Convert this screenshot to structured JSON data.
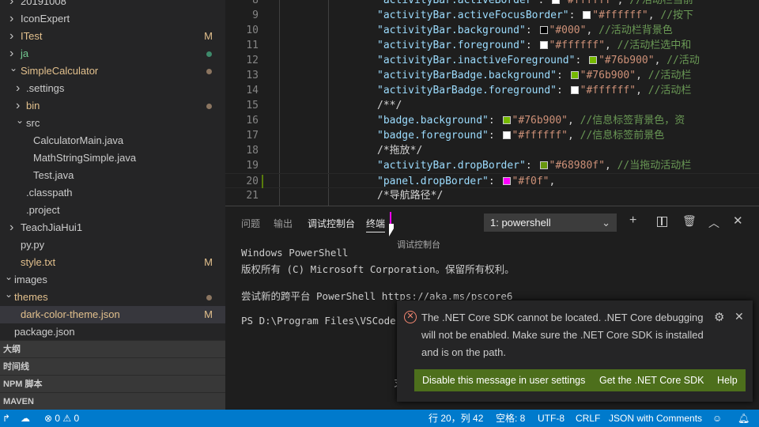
{
  "explorer": {
    "items": [
      {
        "label": "20191008",
        "indent": 0,
        "chevron": "right",
        "cls": ""
      },
      {
        "label": "IconExpert",
        "indent": 0,
        "chevron": "right",
        "cls": ""
      },
      {
        "label": "ITest",
        "indent": 0,
        "chevron": "right",
        "cls": "mod",
        "badge": "M"
      },
      {
        "label": "ja",
        "indent": 0,
        "chevron": "right",
        "cls": "ja",
        "dot": "#3e8a6b"
      },
      {
        "label": "SimpleCalculator",
        "indent": 0,
        "chevron": "down",
        "cls": "mod",
        "dot": "#8b7560"
      },
      {
        "label": ".settings",
        "indent": 1,
        "chevron": "right",
        "cls": ""
      },
      {
        "label": "bin",
        "indent": 1,
        "chevron": "right",
        "cls": "mod",
        "dot": "#8b7560"
      },
      {
        "label": "src",
        "indent": 1,
        "chevron": "down",
        "cls": ""
      },
      {
        "label": "CalculatorMain.java",
        "indent": 2,
        "cls": ""
      },
      {
        "label": "MathStringSimple.java",
        "indent": 2,
        "cls": ""
      },
      {
        "label": "Test.java",
        "indent": 2,
        "cls": ""
      },
      {
        "label": ".classpath",
        "indent": 1,
        "cls": ""
      },
      {
        "label": ".project",
        "indent": 1,
        "cls": ""
      },
      {
        "label": "TeachJiaHui1",
        "indent": 0,
        "chevron": "right",
        "cls": ""
      },
      {
        "label": "py.py",
        "indent": 0,
        "cls": ""
      },
      {
        "label": "style.txt",
        "indent": 0,
        "cls": "mod",
        "badge": "M"
      },
      {
        "label": "images",
        "indent": -1,
        "chevron": "down",
        "cls": ""
      },
      {
        "label": "themes",
        "indent": -1,
        "chevron": "down",
        "cls": "mod",
        "dot": "#8b7560"
      },
      {
        "label": "dark-color-theme.json",
        "indent": 0,
        "cls": "mod",
        "badge": "M",
        "selected": true
      },
      {
        "label": "package.json",
        "indent": -1,
        "cls": ""
      }
    ],
    "sections": [
      "大纲",
      "时间线",
      "NPM 脚本",
      "MAVEN"
    ]
  },
  "editor": {
    "lines": [
      {
        "n": "8",
        "key": "\"activityBar.activeBorder\"",
        "swatch": "#ffffff",
        "value": "\"#ffffff\"",
        "comment": "//活动栏当前"
      },
      {
        "n": "9",
        "key": "\"activityBar.activeFocusBorder\"",
        "swatch": "#ffffff",
        "value": "\"#ffffff\"",
        "comment": "//按下"
      },
      {
        "n": "10",
        "key": "\"activityBar.background\"",
        "swatch": "#000000",
        "value": "\"#000\"",
        "comment": "//活动栏背景色"
      },
      {
        "n": "11",
        "key": "\"activityBar.foreground\"",
        "swatch": "#ffffff",
        "value": "\"#ffffff\"",
        "comment": "//活动栏选中和"
      },
      {
        "n": "12",
        "key": "\"activityBar.inactiveForeground\"",
        "swatch": "#76b900",
        "value": "\"#76b900\"",
        "comment": "//活动"
      },
      {
        "n": "13",
        "key": "\"activityBarBadge.background\"",
        "swatch": "#76b900",
        "value": "\"#76b900\"",
        "comment": "//活动栏"
      },
      {
        "n": "14",
        "key": "\"activityBarBadge.foreground\"",
        "swatch": "#ffffff",
        "value": "\"#ffffff\"",
        "comment": "//活动栏"
      },
      {
        "n": "15",
        "block": "/**/"
      },
      {
        "n": "16",
        "key": "\"badge.background\"",
        "swatch": "#76b900",
        "value": "\"#76b900\"",
        "comment": "//信息标签背景色，资"
      },
      {
        "n": "17",
        "key": "\"badge.foreground\"",
        "swatch": "#ffffff",
        "value": "\"#ffffff\"",
        "comment": "//信息标签前景色"
      },
      {
        "n": "18",
        "block": "/*拖放*/"
      },
      {
        "n": "19",
        "key": "\"activityBar.dropBorder\"",
        "swatch": "#68980f",
        "value": "\"#68980f\"",
        "comment": "//当拖动活动栏"
      },
      {
        "n": "20",
        "key": "\"panel.dropBorder\"",
        "swatch": "#ff00ff",
        "value": "\"#f0f\"",
        "comment": ""
      },
      {
        "n": "21",
        "block": "/*导航路径*/"
      }
    ]
  },
  "panel": {
    "tabs": [
      "问题",
      "输出",
      "调试控制台",
      "终端"
    ],
    "active_tab": 3,
    "drag_tooltip": "调试控制台",
    "terminal_select": "1: powershell",
    "terminal_lines": [
      "Windows PowerShell",
      "版权所有 (C) Microsoft Corporation。保留所有权利。",
      "尝试新的跨平台 PowerShell https://aka.ms/pscore6",
      "PS D:\\Program Files\\VSCode-w"
    ],
    "partial_char": "ヌ"
  },
  "notification": {
    "message": "The .NET Core SDK cannot be located. .NET Core debugging will not be enabled. Make sure the .NET Core SDK is installed and is on the path.",
    "buttons": [
      "Disable this message in user settings",
      "Get the .NET Core SDK",
      "Help"
    ],
    "button_color": "#4d6f1c"
  },
  "status": {
    "errors": "0",
    "warnings": "0",
    "position": "行 20，列 42",
    "spaces": "空格: 8",
    "encoding": "UTF-8",
    "eol": "CRLF",
    "language": "JSON with Comments",
    "color": "#007acc"
  }
}
